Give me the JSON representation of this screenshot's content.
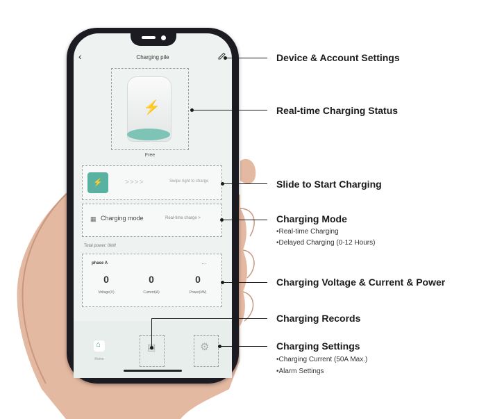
{
  "screen": {
    "title": "Charging pile",
    "status_text": "Free",
    "slide": {
      "button_label": "⚡",
      "chevrons": ">>>>",
      "hint": "Swipe right to charge"
    },
    "mode": {
      "label": "Charging mode",
      "value": "Real-time charge  >"
    },
    "total_line": "Total power:  0kW",
    "phase": {
      "title": "phase A",
      "menu": "...",
      "readings": [
        {
          "value": "0",
          "unit": "Voltage(V)"
        },
        {
          "value": "0",
          "unit": "Current(A)"
        },
        {
          "value": "0",
          "unit": "Power(kW)"
        }
      ]
    },
    "tabs": {
      "home_label": "Home"
    }
  },
  "callouts": {
    "device_settings": "Device & Account Settings",
    "realtime_status": "Real-time Charging Status",
    "slide_start": "Slide to Start Charging",
    "mode_title": "Charging Mode",
    "mode_items": [
      "•Real-time Charging",
      "•Delayed Charging (0-12 Hours)"
    ],
    "vcp": "Charging Voltage & Current & Power",
    "records": "Charging Records",
    "settings_title": "Charging Settings",
    "settings_items": [
      "•Charging Current (50A Max.)",
      "•Alarm Settings"
    ]
  },
  "colors": {
    "accent": "#59b1a2",
    "phone_frame": "#1d1b22",
    "screen_bg": "#eef3f2"
  }
}
